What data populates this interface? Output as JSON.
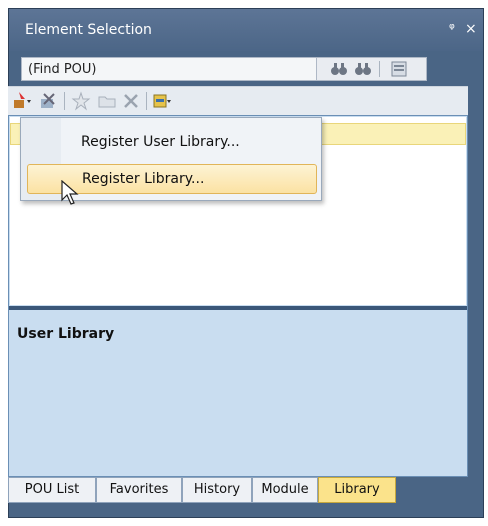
{
  "window": {
    "title": "Element Selection",
    "pin_icon": "pin-icon",
    "close_icon": "close-icon",
    "close_glyph": "×",
    "pin_glyph": "ᵠ"
  },
  "find": {
    "value": "(Find POU)",
    "buttons": [
      "find-previous-icon",
      "find-next-icon",
      "options-icon"
    ]
  },
  "toolbar": {
    "buttons": [
      "register-library-dropdown-icon",
      "unregister-icon",
      "favorites-icon",
      "folder-icon",
      "delete-icon",
      "display-dropdown-icon"
    ]
  },
  "panel": {
    "description_title": "User Library"
  },
  "context_menu": {
    "items": [
      {
        "label": "Register User Library..."
      },
      {
        "label": "Register Library...",
        "hover": true
      }
    ]
  },
  "tabs": [
    {
      "label": "POU List"
    },
    {
      "label": "Favorites"
    },
    {
      "label": "History"
    },
    {
      "label": "Module"
    },
    {
      "label": "Library",
      "active": true
    }
  ],
  "colors": {
    "frame": "#4a6585",
    "panel": "#c9ddf0",
    "selection": "#faf1b7",
    "active_tab": "#fbe38b"
  }
}
